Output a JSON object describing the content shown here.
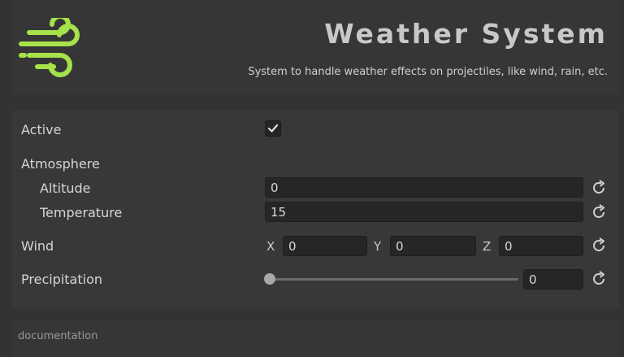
{
  "header": {
    "title": "Weather System",
    "subtitle": "System to handle weather effects on projectiles, like wind, rain, etc.",
    "logo_icon": "wind-icon",
    "logo_color": "#a6e24a"
  },
  "fields": {
    "active": {
      "label": "Active",
      "checked": true
    },
    "atmosphere": {
      "label": "Atmosphere"
    },
    "altitude": {
      "label": "Altitude",
      "value": "0"
    },
    "temperature": {
      "label": "Temperature",
      "value": "15"
    },
    "wind": {
      "label": "Wind",
      "x_label": "X",
      "x_value": "0",
      "y_label": "Y",
      "y_value": "0",
      "z_label": "Z",
      "z_value": "0"
    },
    "precipitation": {
      "label": "Precipitation",
      "value": "0",
      "slider_fraction": 0
    }
  },
  "footer": {
    "link": "documentation"
  },
  "icons": {
    "reset": "refresh-icon",
    "check": "checkmark-icon"
  }
}
